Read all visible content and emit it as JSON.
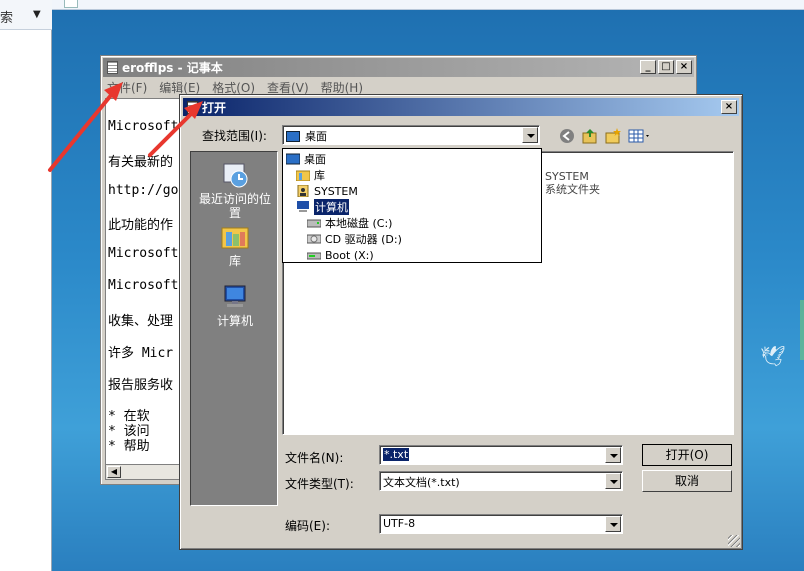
{
  "background": {
    "explorer_search_label": "索",
    "explorer_dropdown_glyph": "▼"
  },
  "notepad": {
    "title": "erofflps - 记事本",
    "menu": [
      "文件(F)",
      "编辑(E)",
      "格式(O)",
      "查看(V)",
      "帮助(H)"
    ],
    "lines": [
      "Microsoft",
      "有关最新的",
      "http://go",
      "此功能的作",
      "Microsoft",
      "Microsoft",
      "收集、处理",
      "许多 Micr",
      "报告服务收",
      "*  在软",
      "*  该问",
      "*  帮助"
    ]
  },
  "open_dialog": {
    "title": "打开",
    "look_in_label": "查找范围(I):",
    "look_in_value": "桌面",
    "places": [
      {
        "label_line1": "最近访问的位",
        "label_line2": "置",
        "icon": "recent-places-icon"
      },
      {
        "label_line1": "库",
        "label_line2": "",
        "icon": "libraries-icon"
      },
      {
        "label_line1": "计算机",
        "label_line2": "",
        "icon": "computer-icon"
      }
    ],
    "dropdown_items": [
      {
        "label": "桌面",
        "icon": "desktop-icon",
        "selected": false
      },
      {
        "label": "库",
        "icon": "libraries-icon",
        "selected": false
      },
      {
        "label": "SYSTEM",
        "icon": "user-folder-icon",
        "selected": false
      },
      {
        "label": "计算机",
        "icon": "computer-icon",
        "selected": true
      },
      {
        "label": "本地磁盘 (C:)",
        "icon": "hard-drive-icon",
        "selected": false
      },
      {
        "label": "CD 驱动器 (D:)",
        "icon": "cd-drive-icon",
        "selected": false
      },
      {
        "label": "Boot (X:)",
        "icon": "removable-drive-icon",
        "selected": false
      }
    ],
    "file_entries": [
      {
        "name": "SYSTEM",
        "type": "系统文件夹"
      }
    ],
    "file_name_label": "文件名(N):",
    "file_name_value": "*.txt",
    "file_type_label": "文件类型(T):",
    "file_type_value": "文本文档(*.txt)",
    "encoding_label": "编码(E):",
    "encoding_value": "UTF-8",
    "open_button": "打开(O)",
    "cancel_button": "取消"
  },
  "colors": {
    "dialog_title_start": "#0a246a",
    "dialog_title_end": "#a6caf0",
    "annotation_arrow": "#e8372e"
  }
}
